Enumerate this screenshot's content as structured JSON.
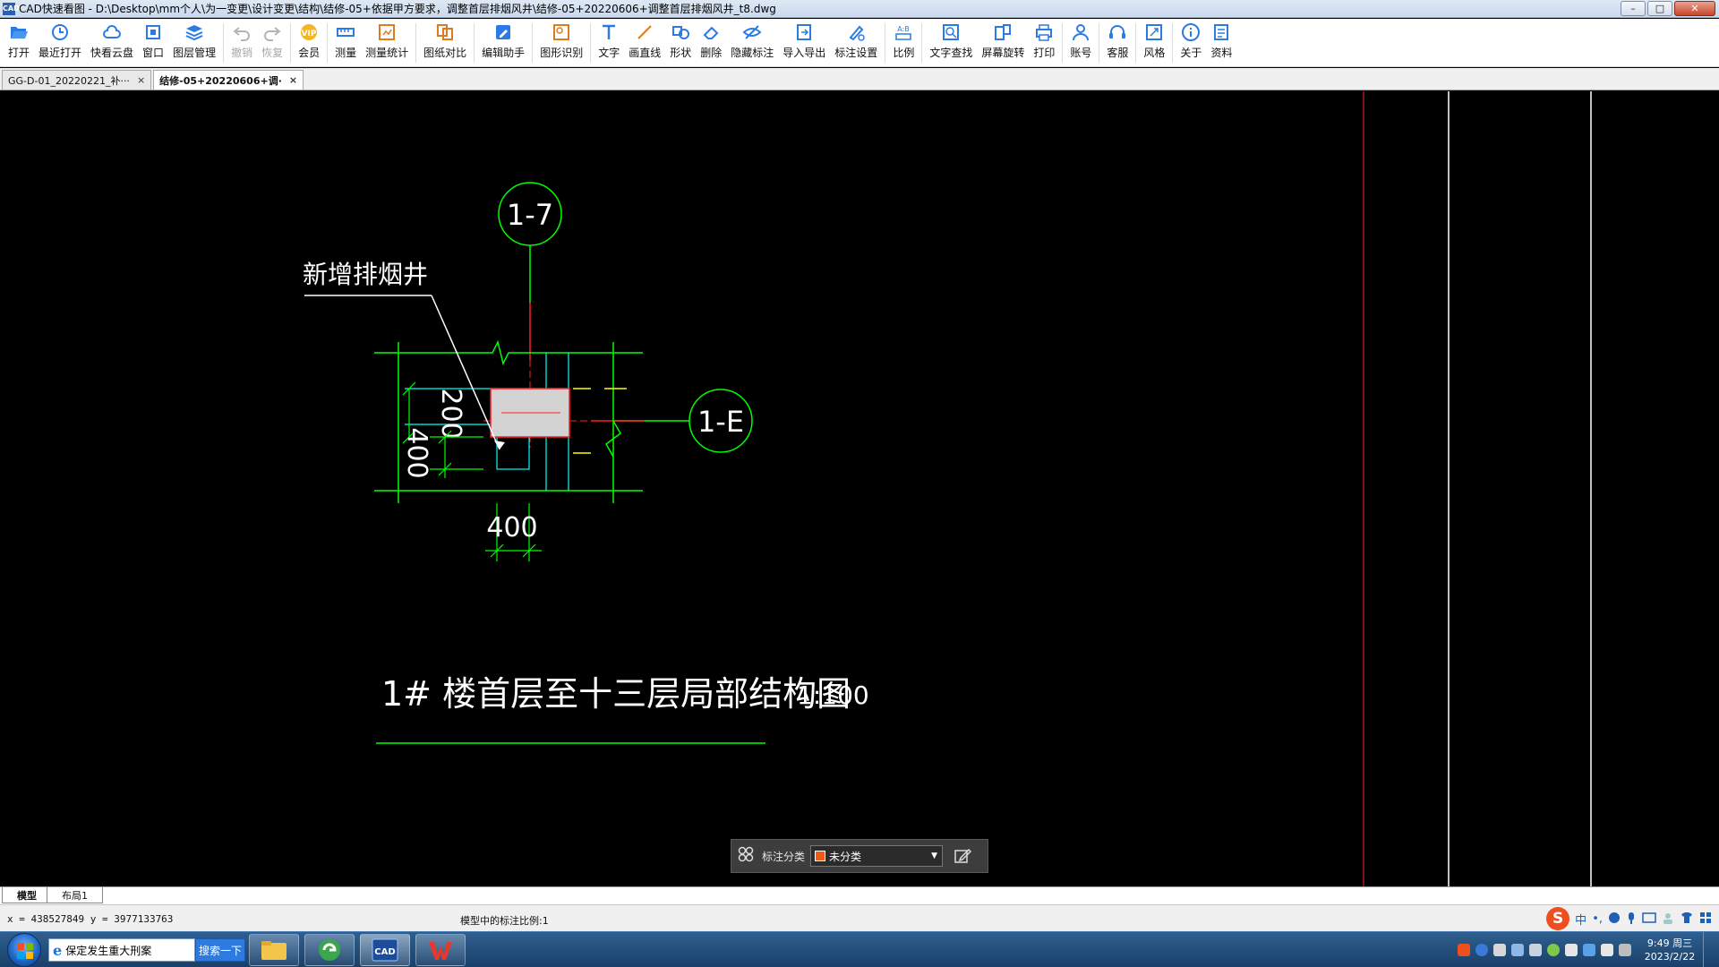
{
  "window": {
    "app_icon_text": "CAD",
    "title": "CAD快速看图 - D:\\Desktop\\mm个人\\为一变更\\设计变更\\结构\\结修-05+依据甲方要求，调整首层排烟风井\\结修-05+20220606+调整首层排烟风井_t8.dwg",
    "min": "–",
    "max": "□",
    "close": "✕"
  },
  "toolbar": [
    {
      "label": "打开",
      "icon": "folder-open-icon",
      "enabled": true
    },
    {
      "label": "最近打开",
      "icon": "history-icon",
      "enabled": true
    },
    {
      "label": "快看云盘",
      "icon": "cloud-icon",
      "enabled": true
    },
    {
      "label": "窗口",
      "icon": "window-icon",
      "enabled": true
    },
    {
      "label": "图层管理",
      "icon": "layers-icon",
      "enabled": true
    },
    {
      "label": "撤销",
      "icon": "undo-icon",
      "enabled": false
    },
    {
      "label": "恢复",
      "icon": "redo-icon",
      "enabled": false
    },
    {
      "label": "会员",
      "icon": "vip-icon",
      "enabled": true
    },
    {
      "label": "测量",
      "icon": "measure-icon",
      "enabled": true
    },
    {
      "label": "测量统计",
      "icon": "measure-stats-icon",
      "enabled": true
    },
    {
      "label": "图纸对比",
      "icon": "compare-icon",
      "enabled": true
    },
    {
      "label": "编辑助手",
      "icon": "edit-assistant-icon",
      "enabled": true
    },
    {
      "label": "图形识别",
      "icon": "shape-recognize-icon",
      "enabled": true
    },
    {
      "label": "文字",
      "icon": "text-icon",
      "enabled": true
    },
    {
      "label": "画直线",
      "icon": "line-icon",
      "enabled": true
    },
    {
      "label": "形状",
      "icon": "shape-icon",
      "enabled": true
    },
    {
      "label": "删除",
      "icon": "eraser-icon",
      "enabled": true
    },
    {
      "label": "隐藏标注",
      "icon": "hide-icon",
      "enabled": true
    },
    {
      "label": "导入导出",
      "icon": "import-export-icon",
      "enabled": true
    },
    {
      "label": "标注设置",
      "icon": "annotation-settings-icon",
      "enabled": true
    },
    {
      "label": "比例",
      "icon": "scale-icon",
      "enabled": true
    },
    {
      "label": "文字查找",
      "icon": "text-search-icon",
      "enabled": true
    },
    {
      "label": "屏幕旋转",
      "icon": "rotate-icon",
      "enabled": true
    },
    {
      "label": "打印",
      "icon": "print-icon",
      "enabled": true
    },
    {
      "label": "账号",
      "icon": "account-icon",
      "enabled": true
    },
    {
      "label": "客服",
      "icon": "headset-icon",
      "enabled": true
    },
    {
      "label": "风格",
      "icon": "style-icon",
      "enabled": true
    },
    {
      "label": "关于",
      "icon": "info-icon",
      "enabled": true
    },
    {
      "label": "资料",
      "icon": "docs-icon",
      "enabled": true
    }
  ],
  "tabs": [
    {
      "label": "GG-D-01_20220221_补···",
      "close": "×",
      "active": false
    },
    {
      "label": "结修-05+20220606+调·",
      "close": "×",
      "active": true
    }
  ],
  "drawing": {
    "axis_top": "1-7",
    "axis_right": "1-E",
    "leader_note": "新增排烟井",
    "dim_200": "200",
    "dim_400_vertical": "400",
    "dim_400_horizontal": "400",
    "title": "1# 楼首层至十三层局部结构图",
    "scale": "1:100"
  },
  "annotation_panel": {
    "label": "标注分类",
    "selected": "未分类",
    "swatch_color": "#f05a14",
    "arrow": "▼"
  },
  "layout_tabs": [
    "模型",
    "布局1"
  ],
  "status": {
    "coords": "x = 438527849  y = 3977133763",
    "scale_text": "模型中的标注比例:1"
  },
  "ime": {
    "logo": "S",
    "lang": "中",
    "punct": "•,"
  },
  "taskbar": {
    "ie_text": "保定发生重大刑案",
    "search_label": "搜索一下",
    "cad_label": "CAD",
    "clock_time": "9:49 周三",
    "clock_date": "2023/2/22"
  },
  "colors": {
    "green": "#00ff00",
    "red": "#ff2020",
    "cyan": "#00ffff",
    "yellow": "#ffff00",
    "white": "#ffffff"
  }
}
